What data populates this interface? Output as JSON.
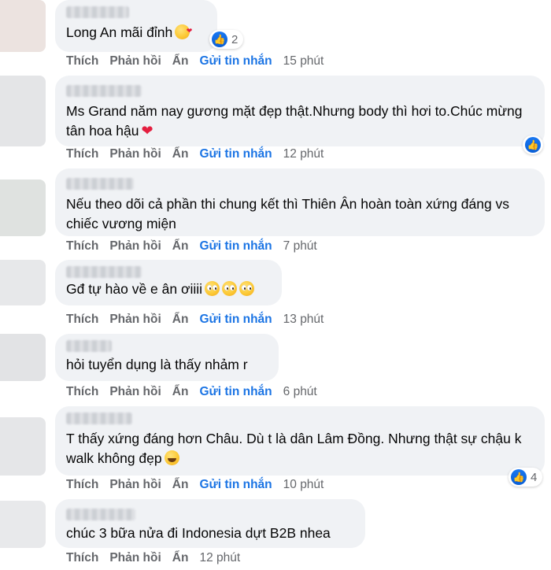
{
  "actions": {
    "like": "Thích",
    "reply": "Phản hồi",
    "hide": "Ẩn",
    "send_message": "Gửi tin nhắn"
  },
  "comments": [
    {
      "text": "Long An mãi đỉnh",
      "emojis": [
        "kiss"
      ],
      "time": "15 phút",
      "reaction_count": "2"
    },
    {
      "text": "Ms Grand năm nay gương mặt đẹp thật.Nhưng body thì hơi to.Chúc mừng tân hoa hậu",
      "emojis": [
        "heart"
      ],
      "time": "12 phút",
      "reaction_count": ""
    },
    {
      "text": "Nếu theo dõi cả phần thi chung kết thì Thiên Ân hoàn toàn xứng đáng vs chiếc vương miện",
      "emojis": [],
      "time": "7 phút",
      "reaction_count": ""
    },
    {
      "text": "Gđ tự hào về e ân ơiiii",
      "emojis": [
        "pleading",
        "pleading",
        "pleading"
      ],
      "time": "13 phút",
      "reaction_count": ""
    },
    {
      "text": "hỏi tuyển dụng là thấy nhảm r",
      "emojis": [],
      "time": "6 phút",
      "reaction_count": ""
    },
    {
      "text": "T thấy xứng đáng hơn Châu. Dù t là dân Lâm Đồng. Nhưng thật sự chậu k walk không đẹp",
      "emojis": [
        "laugh"
      ],
      "time": "10 phút",
      "reaction_count": "4"
    },
    {
      "text": "chúc 3 bữa nửa đi Indonesia dựt B2B nhea",
      "emojis": [],
      "time": "12 phút",
      "reaction_count": ""
    }
  ],
  "colors": {
    "link": "#1b74e4",
    "bubble": "#f0f2f5",
    "like": "#1877f2"
  },
  "icons": {
    "reaction": "like-icon"
  }
}
